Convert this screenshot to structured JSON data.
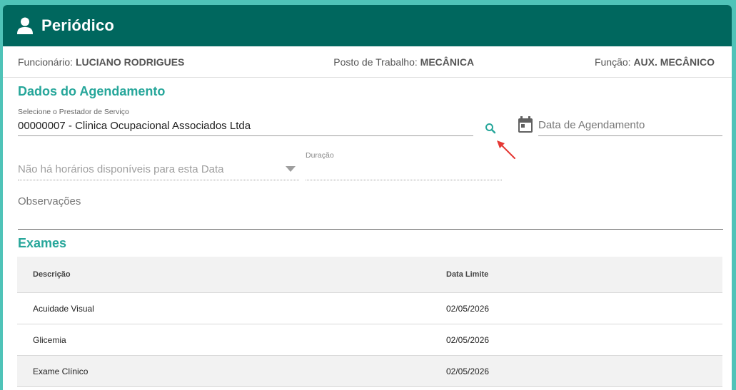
{
  "header": {
    "title": "Periódico",
    "icon": "user-icon"
  },
  "info": {
    "funcionario_label": "Funcionário:",
    "funcionario_value": "LUCIANO RODRIGUES",
    "posto_label": "Posto de Trabalho:",
    "posto_value": "MECÂNICA",
    "funcao_label": "Função:",
    "funcao_value": "AUX. MECÂNICO"
  },
  "agendamento": {
    "title": "Dados do Agendamento",
    "prestador_label": "Selecione o Prestador de Serviço",
    "prestador_value": "00000007 - Clinica Ocupacional Associados Ltda",
    "data_placeholder": "Data de Agendamento",
    "horarios_placeholder": "Não há horários disponíveis para esta Data",
    "duracao_label": "Duração",
    "observacoes_label": "Observações"
  },
  "exames": {
    "title": "Exames",
    "columns": [
      "Descrição",
      "Data Limite"
    ],
    "rows": [
      [
        "Acuidade Visual",
        "02/05/2026"
      ],
      [
        "Glicemia",
        "02/05/2026"
      ],
      [
        "Exame Clínico",
        "02/05/2026"
      ]
    ]
  },
  "colors": {
    "header": "#00675e",
    "accent": "#26a69a",
    "annotation_arrow": "#e53935"
  }
}
